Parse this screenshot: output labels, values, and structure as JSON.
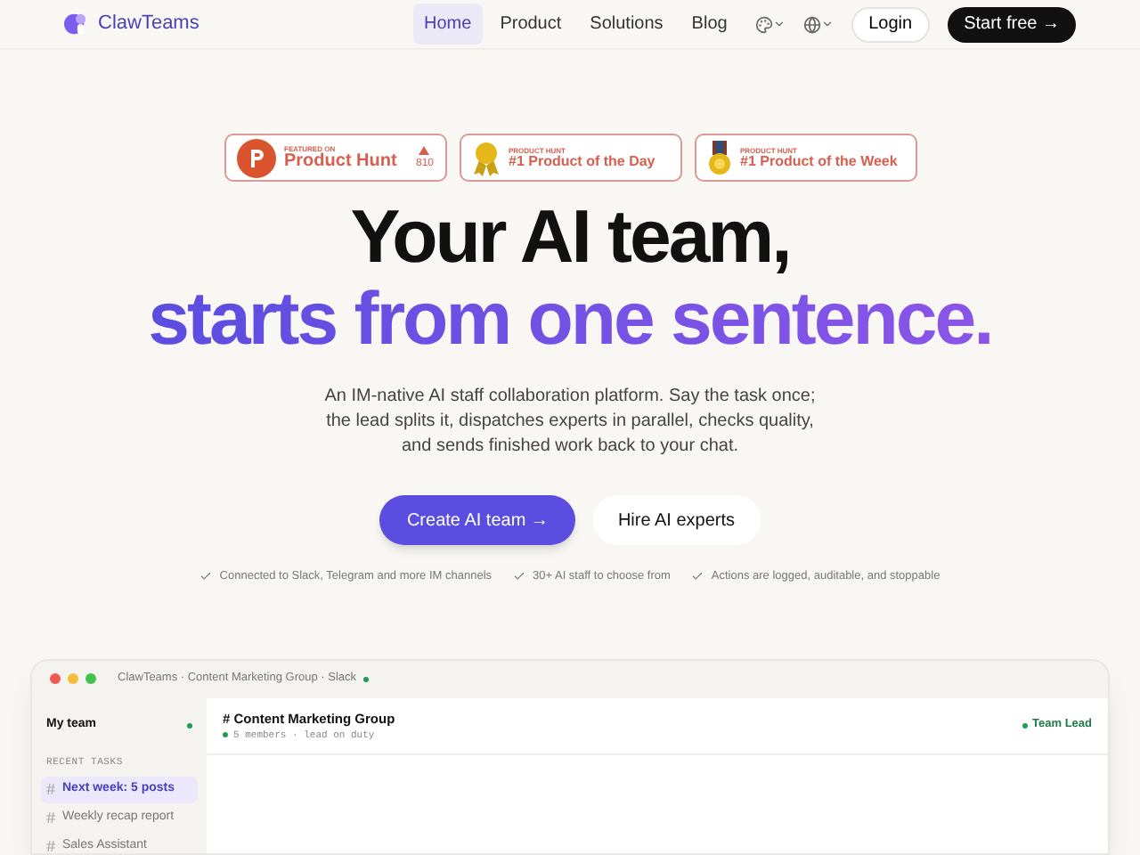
{
  "brand": {
    "name": "ClawTeams"
  },
  "nav": [
    {
      "label": "Home",
      "selected": true
    },
    {
      "label": "Product",
      "selected": false
    },
    {
      "label": "Solutions",
      "selected": false
    },
    {
      "label": "Blog",
      "selected": false
    }
  ],
  "actions": {
    "login": "Login",
    "start": "Start free →"
  },
  "badges": [
    {
      "kind": "hunt",
      "caption": "FEATURED ON",
      "title": "Product Hunt",
      "count": "810"
    },
    {
      "kind": "day",
      "caption": "PRODUCT HUNT",
      "title": "#1 Product of the Day"
    },
    {
      "kind": "week",
      "caption": "PRODUCT HUNT",
      "title": "#1 Product of the Week"
    }
  ],
  "hero": {
    "line1": "Your AI team,",
    "line2": "starts from one sentence.",
    "description": "An IM-native AI staff collaboration platform. Say the task once; the lead splits it, dispatches experts in parallel, checks quality, and sends finished work back to your chat."
  },
  "cta": {
    "primary": "Create AI team →",
    "secondary": "Hire AI experts"
  },
  "features": [
    "Connected to Slack, Telegram and more IM channels",
    "30+ AI staff to choose from",
    "Actions are logged, auditable, and stoppable"
  ],
  "app": {
    "title": "ClawTeams · Content Marketing Group · Slack",
    "sidebar_title": "My team",
    "section": "RECENT TASKS",
    "tasks": [
      {
        "label": "Next week: 5 posts",
        "selected": true
      },
      {
        "label": "Weekly recap report",
        "selected": false
      },
      {
        "label": "Sales Assistant",
        "selected": false
      }
    ],
    "channel": "# Content Marketing Group",
    "meta": "5 members · lead on duty",
    "role": "Team Lead"
  }
}
